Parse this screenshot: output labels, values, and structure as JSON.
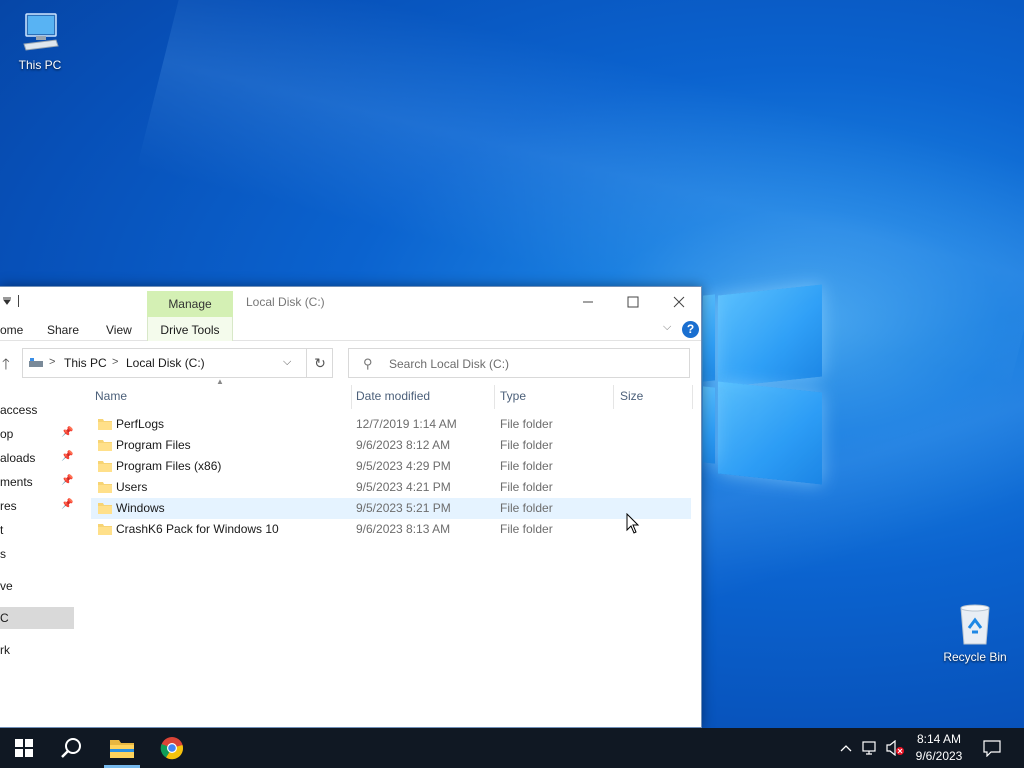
{
  "desktop": {
    "icons": [
      {
        "label": "This PC"
      },
      {
        "label": "Recycle Bin"
      }
    ]
  },
  "window": {
    "title": "Local Disk (C:)",
    "manage_tab": "Manage",
    "ribbon_tabs": [
      "ome",
      "Share",
      "View"
    ],
    "drive_tools": "Drive Tools",
    "help": "?",
    "controls": {
      "minimize": "—",
      "maximize": "☐",
      "close": "✕"
    }
  },
  "address": {
    "crumbs": [
      "This PC",
      "Local Disk (C:)"
    ],
    "separator": ">"
  },
  "search": {
    "placeholder": "Search Local Disk (C:)"
  },
  "nav_pane": {
    "items": [
      {
        "label": "access",
        "pinned": false
      },
      {
        "label": "op",
        "pinned": true
      },
      {
        "label": "aloads",
        "pinned": true
      },
      {
        "label": "ments",
        "pinned": true
      },
      {
        "label": "res",
        "pinned": true
      },
      {
        "label": "t",
        "pinned": false
      },
      {
        "label": "s",
        "pinned": false
      },
      {
        "label": "ve",
        "pinned": false
      },
      {
        "label": "C",
        "pinned": false,
        "selected": true
      },
      {
        "label": "rk",
        "pinned": false
      }
    ]
  },
  "columns": {
    "name": "Name",
    "date": "Date modified",
    "type": "Type",
    "size": "Size"
  },
  "files": [
    {
      "name": "PerfLogs",
      "date": "12/7/2019 1:14 AM",
      "type": "File folder"
    },
    {
      "name": "Program Files",
      "date": "9/6/2023 8:12 AM",
      "type": "File folder"
    },
    {
      "name": "Program Files (x86)",
      "date": "9/5/2023 4:29 PM",
      "type": "File folder"
    },
    {
      "name": "Users",
      "date": "9/5/2023 4:21 PM",
      "type": "File folder"
    },
    {
      "name": "Windows",
      "date": "9/5/2023 5:21 PM",
      "type": "File folder",
      "hover": true
    },
    {
      "name": "CrashK6 Pack for Windows 10",
      "date": "9/6/2023 8:13 AM",
      "type": "File folder"
    }
  ],
  "taskbar": {
    "clock_time": "8:14 AM",
    "clock_date": "9/6/2023",
    "icons": [
      "start-icon",
      "search-icon",
      "file-explorer-icon",
      "chrome-icon"
    ]
  },
  "colors": {
    "accent": "#0078d7",
    "manage_tab": "#d4f0b4",
    "taskbar": "#101823",
    "hover_row": "#e5f3ff"
  }
}
